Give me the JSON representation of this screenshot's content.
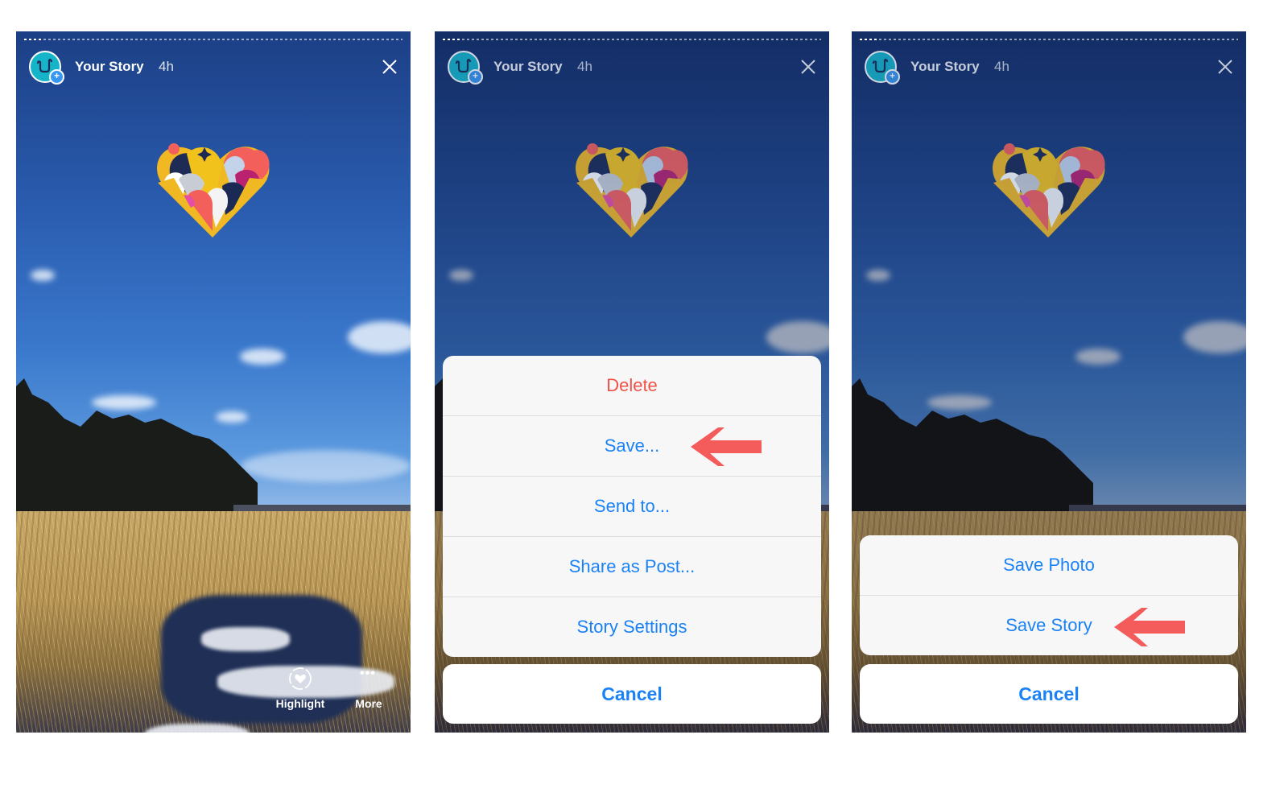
{
  "colors": {
    "ios_blue": "#1a82f5",
    "destructive_red": "#f0524a",
    "annotation_arrow": "#f45b5b",
    "avatar_teal": "#16b4c9",
    "badge_blue": "#3897f0"
  },
  "screens": [
    {
      "header": {
        "title": "Your Story",
        "time": "4h",
        "close_icon": "close-icon",
        "progress_segments_viewed_fraction": 0.05
      },
      "actions": [
        {
          "label": "Highlight",
          "icon": "heart-circle-icon"
        },
        {
          "label": "More",
          "icon": "ellipsis-icon"
        }
      ]
    },
    {
      "header": {
        "title": "Your Story",
        "time": "4h",
        "close_icon": "close-icon"
      },
      "sheet": {
        "items": [
          {
            "label": "Delete",
            "style": "destructive"
          },
          {
            "label": "Save...",
            "style": "default",
            "annotated": true
          },
          {
            "label": "Send to...",
            "style": "default"
          },
          {
            "label": "Share as Post...",
            "style": "default"
          },
          {
            "label": "Story Settings",
            "style": "default"
          }
        ],
        "cancel_label": "Cancel"
      }
    },
    {
      "header": {
        "title": "Your Story",
        "time": "4h",
        "close_icon": "close-icon"
      },
      "sheet": {
        "items": [
          {
            "label": "Save Photo",
            "style": "default"
          },
          {
            "label": "Save Story",
            "style": "default",
            "annotated": true
          }
        ],
        "cancel_label": "Cancel"
      }
    }
  ]
}
